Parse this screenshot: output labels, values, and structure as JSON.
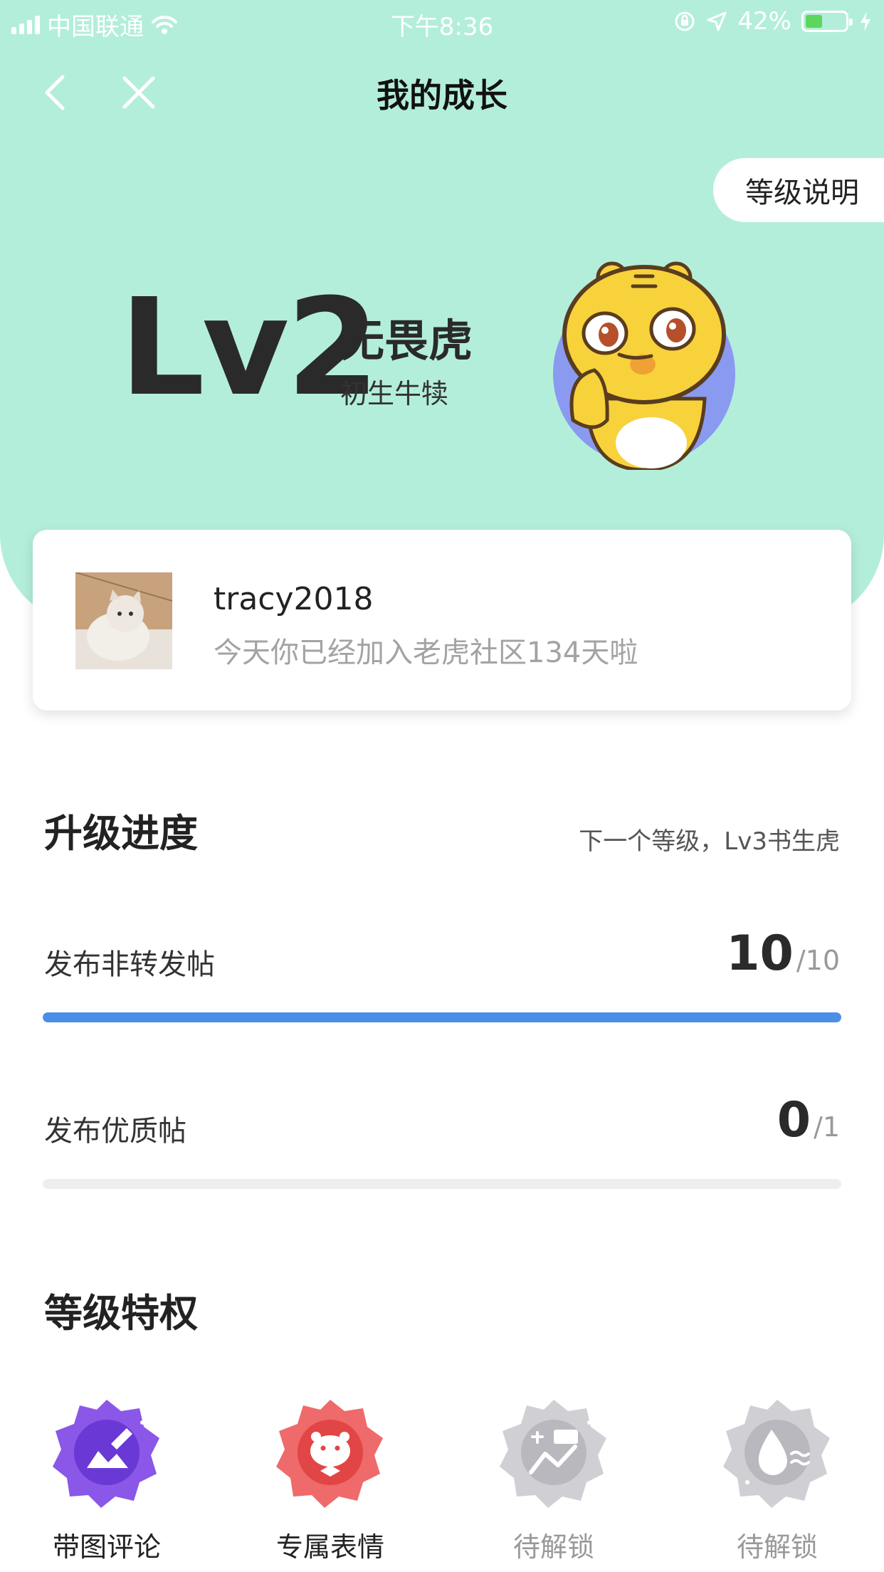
{
  "status_bar": {
    "carrier": "中国联通",
    "time": "下午8:36",
    "battery": "42%",
    "battery_level": 0.42
  },
  "nav": {
    "title": "我的成长"
  },
  "level_desc_button": "等级说明",
  "level": {
    "code": "Lv2",
    "name": "无畏虎",
    "subtitle": "初生牛犊"
  },
  "user": {
    "username": "tracy2018",
    "join_text": "今天你已经加入老虎社区134天啦"
  },
  "progress": {
    "title": "升级进度",
    "next_level": "下一个等级，Lv3书生虎",
    "tasks": [
      {
        "label": "发布非转发帖",
        "current": "10",
        "total": "/10",
        "fraction": 1.0
      },
      {
        "label": "发布优质帖",
        "current": "0",
        "total": "/1",
        "fraction": 0.0
      }
    ]
  },
  "privileges": {
    "title": "等级特权",
    "items": [
      {
        "label": "带图评论",
        "icon": "image-comment-badge-icon",
        "locked": false,
        "color": "#8a57e8"
      },
      {
        "label": "专属表情",
        "icon": "exclusive-emoji-badge-icon",
        "locked": false,
        "color": "#ef6a6a"
      },
      {
        "label": "待解锁",
        "icon": "chart-comment-badge-icon",
        "locked": true,
        "color": "#d0d0d4"
      },
      {
        "label": "待解锁",
        "icon": "water-drop-badge-icon",
        "locked": true,
        "color": "#d0d0d4"
      }
    ]
  },
  "colors": {
    "header_bg": "#b3eedb",
    "progress_fill": "#4a8ee8",
    "progress_track": "#eeeeee"
  }
}
